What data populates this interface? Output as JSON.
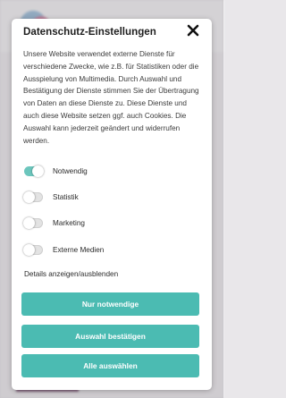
{
  "dialog": {
    "title": "Datenschutz-Einstellungen",
    "description": "Unsere Website verwendet externe Dienste für verschiedene Zwecke, wie z.B. für Statistiken oder die Ausspielung von Multimedia. Durch Auswahl und Bestätigung der Dienste stimmen Sie der Übertragung von Daten an diese Dienste zu. Diese Dienste und auch diese Website setzen ggf. auch Cookies. Die Auswahl kann jederzeit geändert und widerrufen werden.",
    "close_icon": "close-icon",
    "options": [
      {
        "label": "Notwendig",
        "checked": true
      },
      {
        "label": "Statistik",
        "checked": false
      },
      {
        "label": "Marketing",
        "checked": false
      },
      {
        "label": "Externe Medien",
        "checked": false
      }
    ],
    "details_link": "Details anzeigen/ausblenden",
    "buttons": {
      "necessary_only": "Nur notwendige",
      "confirm_selection": "Auswahl bestätigen",
      "select_all": "Alle auswählen"
    },
    "accent_color": "#4bbbb2"
  }
}
